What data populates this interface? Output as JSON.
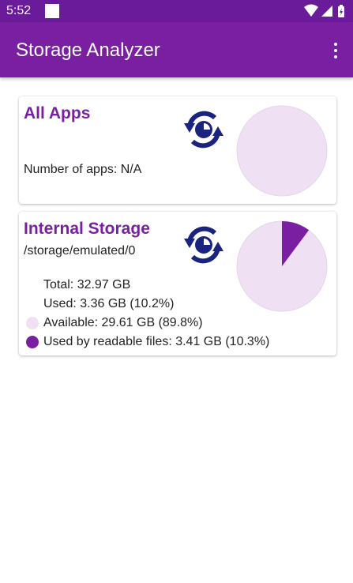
{
  "status_bar": {
    "time": "5:52"
  },
  "app_bar": {
    "title": "Storage Analyzer",
    "menu_icon": "more-vert-icon"
  },
  "colors": {
    "primary": "#7b1fa2",
    "status": "#6a1b9a",
    "pie_bg": "#efe1f3",
    "pie_used": "#7b1fa2"
  },
  "apps_card": {
    "title": "All Apps",
    "num_apps_label": "Number of apps: N/A",
    "refresh_icon": "refresh-chart-icon"
  },
  "storage_card": {
    "title": "Internal Storage",
    "path": "/storage/emulated/0",
    "total": "Total: 32.97 GB",
    "used": "Used: 3.36 GB (10.2%)",
    "available": "Available: 29.61 GB (89.8%)",
    "readable": "Used by readable files: 3.41 GB (10.3%)",
    "used_fraction": 0.102,
    "refresh_icon": "refresh-chart-icon"
  }
}
